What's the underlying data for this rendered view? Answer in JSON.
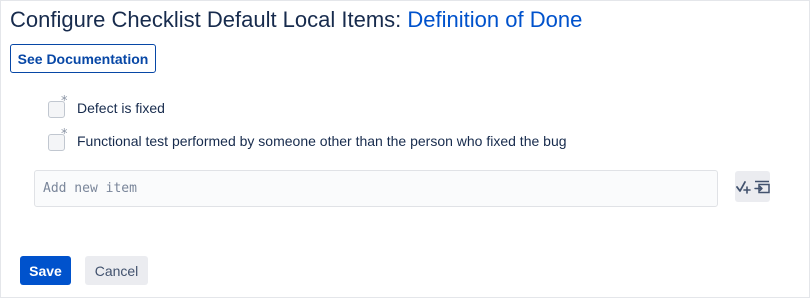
{
  "page": {
    "title_prefix": "Configure Checklist Default Local Items:",
    "title_link": "Definition of Done"
  },
  "toolbar": {
    "documentation_label": "See Documentation"
  },
  "checklist": {
    "items": [
      {
        "label": "Defect is fixed",
        "checked": false,
        "mandatory_marker": "*"
      },
      {
        "label": "Functional test performed by someone other than the person who fixed the bug",
        "checked": false,
        "mandatory_marker": "*"
      }
    ]
  },
  "new_item": {
    "placeholder": "Add new item",
    "value": "",
    "tools": [
      "add-mandatory-item-icon",
      "insert-header-icon"
    ]
  },
  "actions": {
    "save_label": "Save",
    "cancel_label": "Cancel"
  },
  "colors": {
    "accent": "#0052cc",
    "text": "#172b4d",
    "link": "#0052cc"
  }
}
